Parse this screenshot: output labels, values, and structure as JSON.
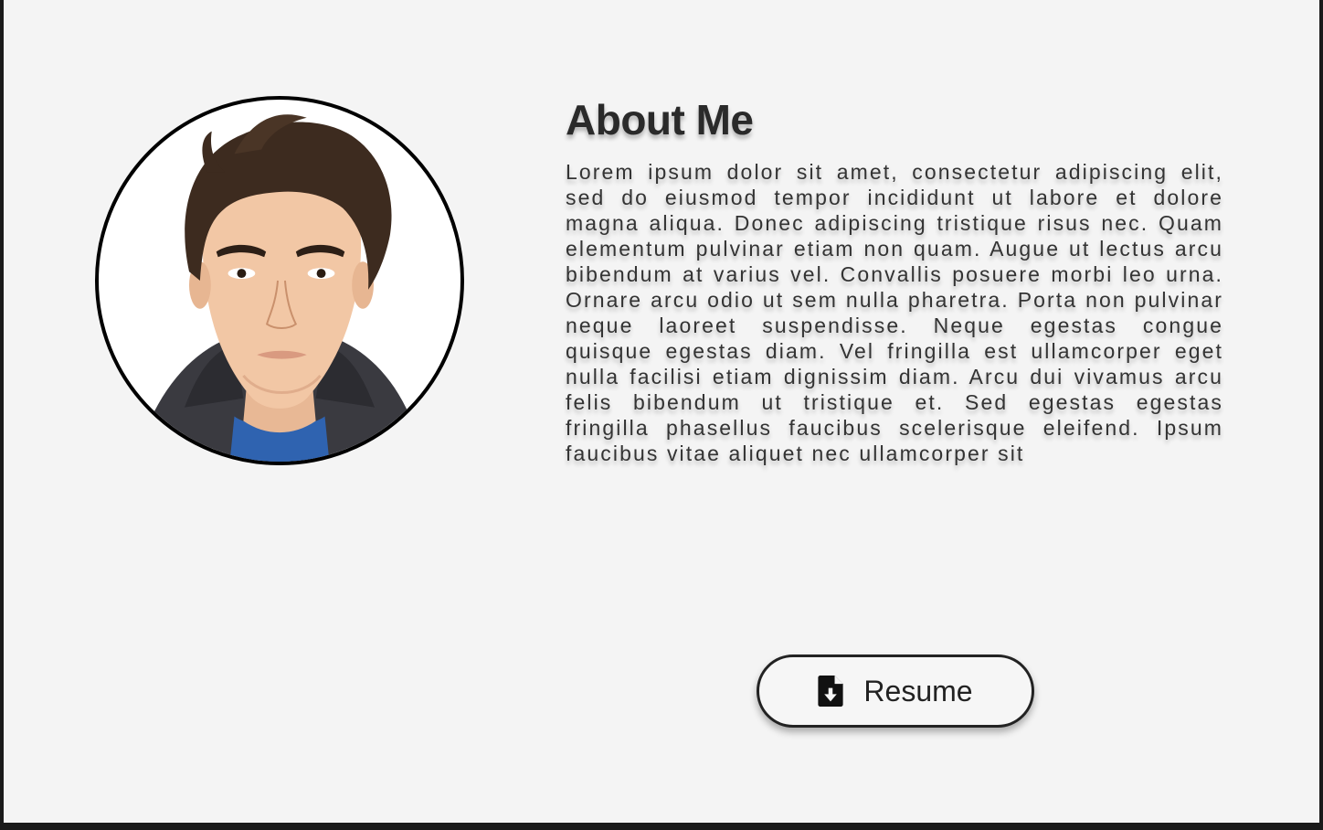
{
  "about": {
    "title": "About Me",
    "body": "Lorem ipsum dolor sit amet, consectetur adipiscing elit, sed do eiusmod tempor incididunt ut labore et dolore magna aliqua. Donec adipiscing tristique risus nec. Quam elementum pulvinar etiam non quam. Augue ut lectus arcu bibendum at varius vel. Convallis posuere morbi leo urna. Ornare arcu odio ut sem nulla pharetra. Porta non pulvinar neque laoreet suspendisse. Neque egestas congue quisque egestas diam. Vel fringilla est ullamcorper eget nulla facilisi etiam dignissim diam. Arcu dui vivamus arcu felis bibendum ut tristique et. Sed egestas egestas fringilla phasellus faucibus scelerisque eleifend. Ipsum faucibus vitae aliquet nec ullamcorper sit"
  },
  "avatar": {
    "icon": "avatar-portrait-illustration"
  },
  "resume_button": {
    "label": "Resume",
    "icon": "file-download-icon"
  },
  "colors": {
    "background": "#f4f4f4",
    "text": "#2a2a2a",
    "border": "#000000"
  }
}
